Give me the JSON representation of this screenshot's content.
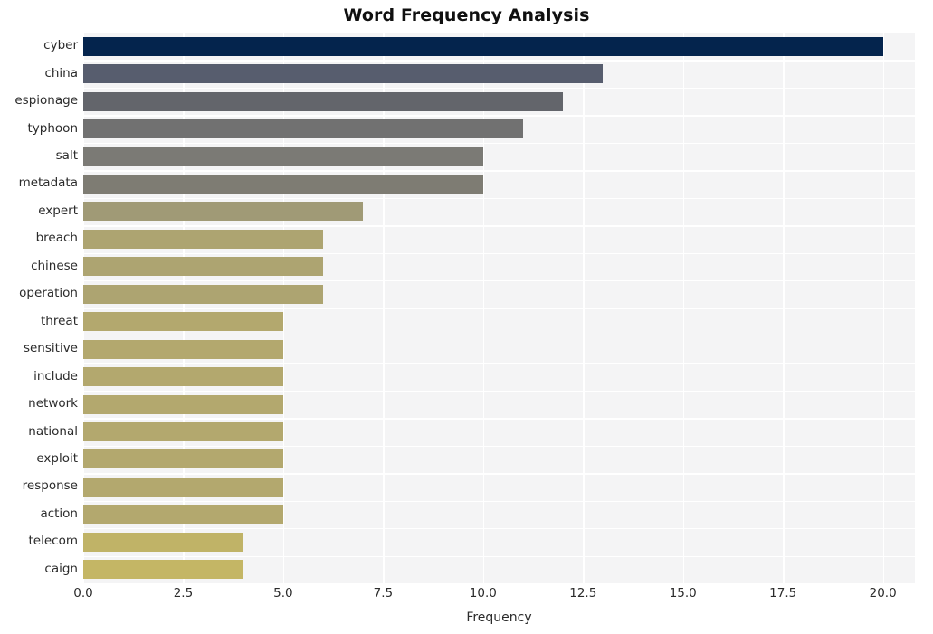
{
  "chart_data": {
    "type": "bar",
    "orientation": "horizontal",
    "title": "Word Frequency Analysis",
    "xlabel": "Frequency",
    "ylabel": "",
    "xlim": [
      0,
      20.8
    ],
    "ylim": [
      0,
      20
    ],
    "grid": true,
    "legend": false,
    "xticks": [
      "0.0",
      "2.5",
      "5.0",
      "7.5",
      "10.0",
      "12.5",
      "15.0",
      "17.5",
      "20.0"
    ],
    "xtick_values": [
      0,
      2.5,
      5,
      7.5,
      10,
      12.5,
      15,
      17.5,
      20
    ],
    "categories": [
      "cyber",
      "china",
      "espionage",
      "typhoon",
      "salt",
      "metadata",
      "expert",
      "breach",
      "chinese",
      "operation",
      "threat",
      "sensitive",
      "include",
      "network",
      "national",
      "exploit",
      "response",
      "action",
      "telecom",
      "caign"
    ],
    "values": [
      20,
      13,
      12,
      11,
      10,
      10,
      7,
      6,
      6,
      6,
      5,
      5,
      5,
      5,
      5,
      5,
      5,
      5,
      4,
      4
    ],
    "bar_colors": [
      "#04244d",
      "#575d6e",
      "#63656b",
      "#717171",
      "#7b7a75",
      "#7e7c73",
      "#a09a76",
      "#ada471",
      "#ada471",
      "#ada471",
      "#b3a86e",
      "#b3a86e",
      "#b3a86e",
      "#b3a86e",
      "#b3a86e",
      "#b3a86e",
      "#b3a86e",
      "#b3a86e",
      "#c0b367",
      "#c4b665"
    ],
    "plot_background": "#f4f4f5",
    "gridline_color": "#ffffff",
    "figure_background": "#ffffff"
  }
}
